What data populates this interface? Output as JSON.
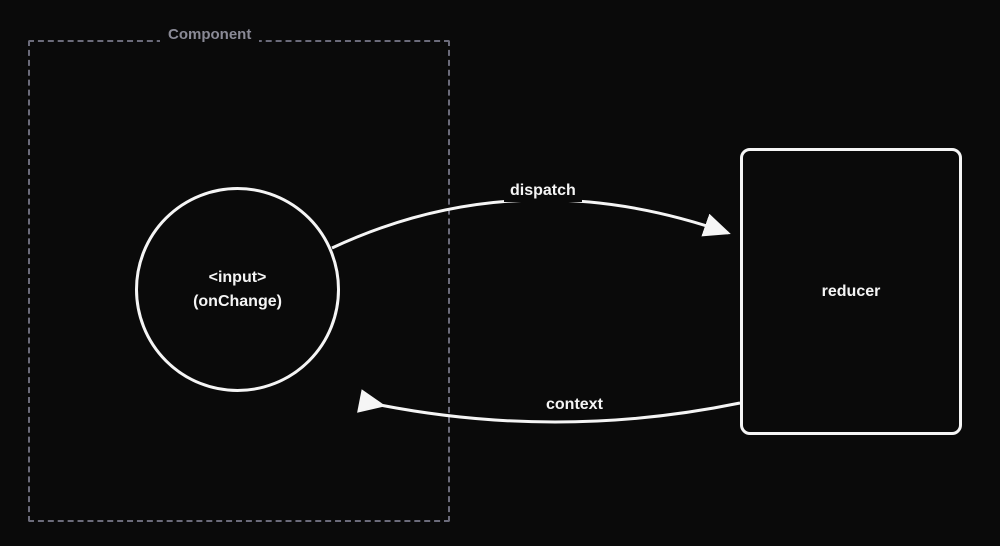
{
  "component": {
    "label": "Component"
  },
  "inputNode": {
    "line1": "<input>",
    "line2": "(onChange)"
  },
  "reducerNode": {
    "label": "reducer"
  },
  "arrows": {
    "dispatch": {
      "label": "dispatch"
    },
    "context": {
      "label": "context"
    }
  }
}
